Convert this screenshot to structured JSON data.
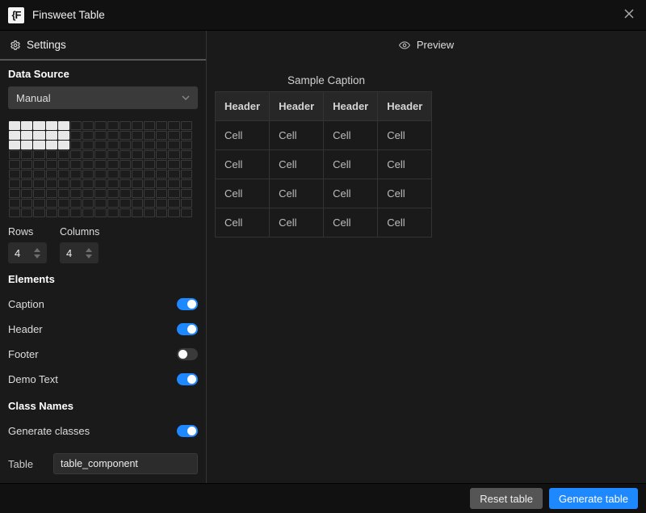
{
  "titlebar": {
    "logo": "{F",
    "title": "Finsweet Table"
  },
  "tabs": {
    "settings": "Settings",
    "preview": "Preview"
  },
  "dataSource": {
    "title": "Data Source",
    "selected": "Manual"
  },
  "picker": {
    "rows": 10,
    "cols": 15,
    "sel_rows": 3,
    "sel_cols": 5
  },
  "dims": {
    "rows_label": "Rows",
    "rows_value": "4",
    "cols_label": "Columns",
    "cols_value": "4"
  },
  "elements": {
    "title": "Elements",
    "items": [
      {
        "label": "Caption",
        "on": true
      },
      {
        "label": "Header",
        "on": true
      },
      {
        "label": "Footer",
        "on": false
      },
      {
        "label": "Demo Text",
        "on": true
      }
    ]
  },
  "classNames": {
    "title": "Class Names",
    "gen_label": "Generate classes",
    "gen_on": true,
    "table_label": "Table",
    "table_value": "table_component"
  },
  "preview": {
    "caption": "Sample Caption",
    "headers": [
      "Header",
      "Header",
      "Header",
      "Header"
    ],
    "rows": [
      [
        "Cell",
        "Cell",
        "Cell",
        "Cell"
      ],
      [
        "Cell",
        "Cell",
        "Cell",
        "Cell"
      ],
      [
        "Cell",
        "Cell",
        "Cell",
        "Cell"
      ],
      [
        "Cell",
        "Cell",
        "Cell",
        "Cell"
      ]
    ]
  },
  "footer": {
    "reset": "Reset table",
    "generate": "Generate table"
  }
}
